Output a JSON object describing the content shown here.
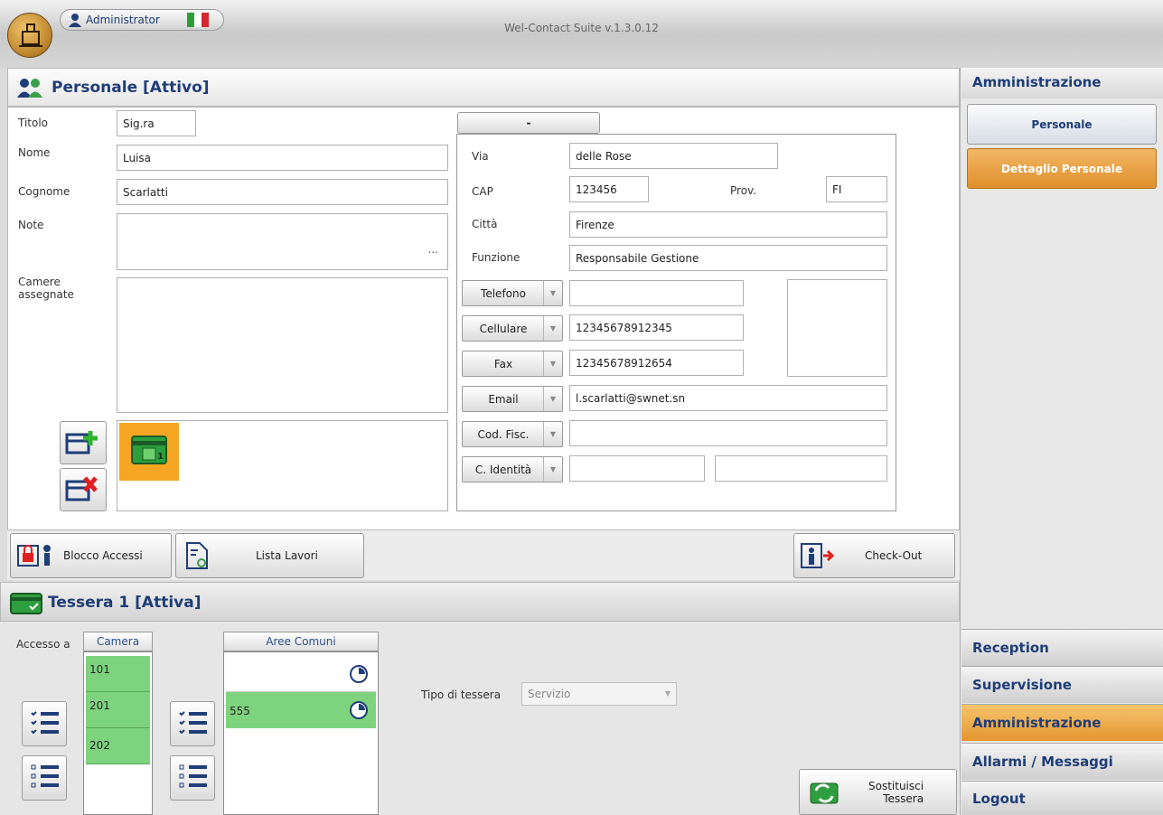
{
  "window": {
    "title": "Wel-Contact Suite v.1.3.0.12",
    "user": "Administrator"
  },
  "personale": {
    "header": "Personale [Attivo]",
    "labels": {
      "titolo": "Titolo",
      "nome": "Nome",
      "cognome": "Cognome",
      "note": "Note",
      "camere": "Camere\nassegnate"
    },
    "values": {
      "titolo": "Sig.ra",
      "nome": "Luisa",
      "cognome": "Scarlatti",
      "note_more": "..."
    },
    "card_number": "1",
    "address_tab": "-",
    "address": {
      "via_label": "Via",
      "via": "delle Rose",
      "cap_label": "CAP",
      "cap": "123456",
      "prov_label": "Prov.",
      "prov": "FI",
      "citta_label": "Città",
      "citta": "Firenze",
      "funzione_label": "Funzione",
      "funzione": "Responsabile Gestione"
    },
    "contacts": [
      {
        "type": "Telefono",
        "value": ""
      },
      {
        "type": "Cellulare",
        "value": "12345678912345"
      },
      {
        "type": "Fax",
        "value": "12345678912654"
      },
      {
        "type": "Email",
        "value": "l.scarlatti@swnet.sn"
      },
      {
        "type": "Cod. Fisc.",
        "value": ""
      },
      {
        "type": "C. Identità",
        "value": "",
        "value2": ""
      }
    ],
    "actions": {
      "blocco": "Blocco Accessi",
      "lista": "Lista Lavori",
      "checkout": "Check-Out"
    }
  },
  "tessera": {
    "header": "Tessera 1 [Attiva]",
    "accesso_label": "Accesso a",
    "camera_header": "Camera",
    "camere": [
      "101",
      "201",
      "202"
    ],
    "aree_header": "Aree Comuni",
    "aree": [
      "",
      "555"
    ],
    "tipo_label": "Tipo di tessera",
    "tipo_value": "Servizio",
    "sostituisci": "Sostituisci\nTessera"
  },
  "sidebar": {
    "section": "Amministrazione",
    "items": [
      "Personale",
      "Dettaglio Personale"
    ],
    "nav": [
      "Reception",
      "Supervisione",
      "Amministrazione",
      "Allarmi / Messaggi",
      "Logout"
    ]
  },
  "colors": {
    "accent": "#1f3d78",
    "selected": "#e8a24a",
    "green": "#7ed37e",
    "card_bg": "#f5a623"
  }
}
